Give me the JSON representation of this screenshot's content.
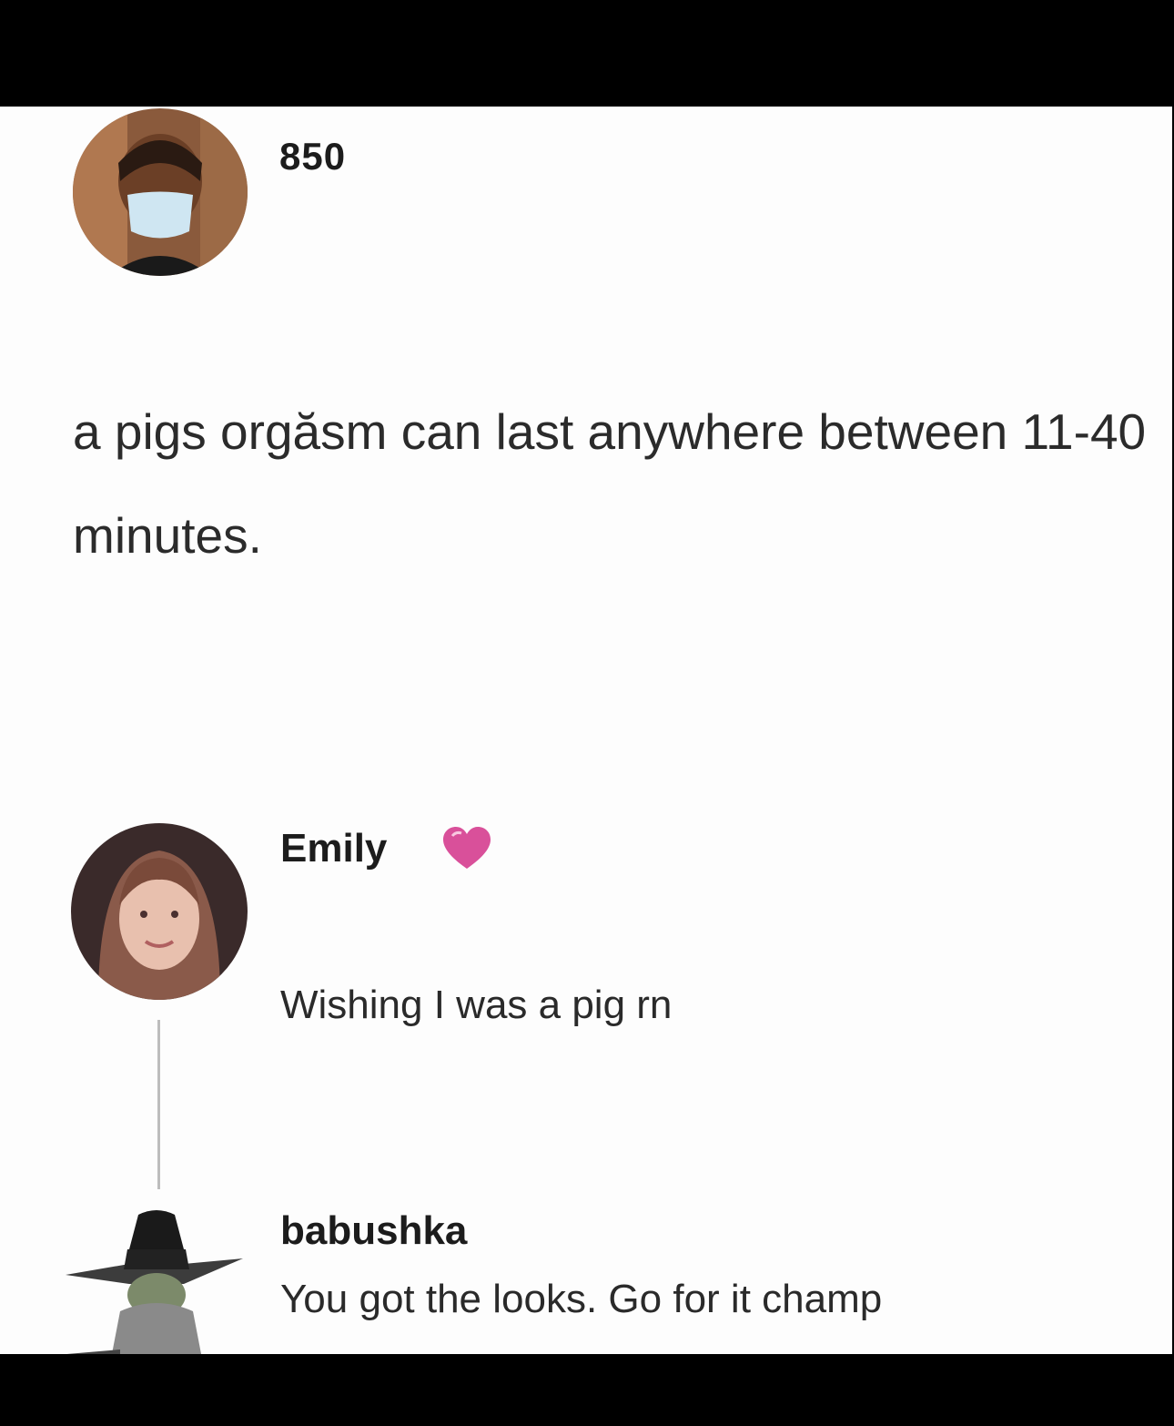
{
  "post": {
    "username": "850",
    "text": "a pigs orgăsm can last anywhere between 11-40 minutes.",
    "avatar_icon": "masked-person-avatar"
  },
  "comments": [
    {
      "username": "Emily",
      "badge_icon": "pink-heart-icon",
      "text": "Wishing I was a pig rn",
      "avatar_icon": "woman-avatar"
    },
    {
      "username": "babushka",
      "text": "You got the looks. Go for it champ",
      "avatar_icon": "baby-yoda-avatar"
    }
  ],
  "colors": {
    "frame": "#000000",
    "card": "#fdfdfd",
    "text": "#2b2b2b",
    "heart": "#d9509a",
    "thread_line": "#bdbdbd"
  }
}
